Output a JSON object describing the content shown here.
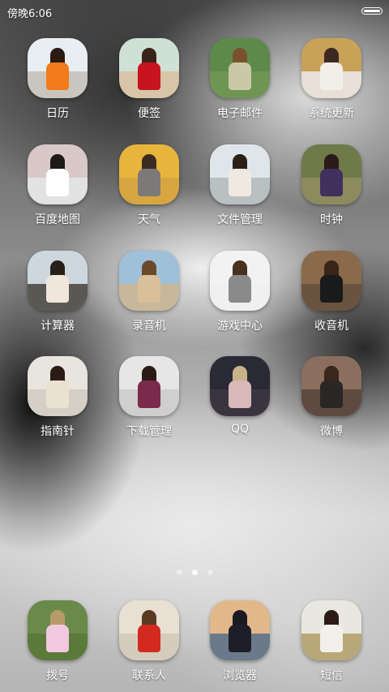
{
  "status_bar": {
    "time": "傍晚6:06"
  },
  "apps": [
    {
      "label": "日历",
      "icon": "woman-orange-dress-photo",
      "colors": {
        "sky": "#e9eef2",
        "ground": "#c9c6c0",
        "hair": "#2b1a12",
        "dress": "#f27a1a"
      }
    },
    {
      "label": "便签",
      "icon": "woman-red-dress-beach-photo",
      "colors": {
        "sky": "#cfe0d4",
        "ground": "#d8c4a6",
        "hair": "#3a2418",
        "dress": "#c8141e"
      }
    },
    {
      "label": "电子邮件",
      "icon": "woman-sequin-dress-photo",
      "colors": {
        "sky": "#5d8a4a",
        "ground": "#6f9552",
        "hair": "#7a5030",
        "dress": "#c9c9a8"
      }
    },
    {
      "label": "系统更新",
      "icon": "woman-white-top-photo",
      "colors": {
        "sky": "#c9a25a",
        "ground": "#e8e0d6",
        "hair": "#3c2a20",
        "dress": "#f2efe9"
      }
    },
    {
      "label": "百度地图",
      "icon": "woman-braid-photo",
      "colors": {
        "sky": "#d9c8c8",
        "ground": "#e2e2e2",
        "hair": "#1e1a18",
        "dress": "#ffffff"
      }
    },
    {
      "label": "天气",
      "icon": "woman-grey-dress-photo",
      "colors": {
        "sky": "#e8b53c",
        "ground": "#d8a640",
        "hair": "#3a2c22",
        "dress": "#7c7a78"
      }
    },
    {
      "label": "文件管理",
      "icon": "woman-balcony-photo",
      "colors": {
        "sky": "#dfe6ea",
        "ground": "#b9c0c2",
        "hair": "#2a2018",
        "dress": "#efe9e2"
      }
    },
    {
      "label": "时钟",
      "icon": "woman-purple-dress-photo",
      "colors": {
        "sky": "#6e7a4a",
        "ground": "#8d8a5e",
        "hair": "#2a1a18",
        "dress": "#41305e"
      }
    },
    {
      "label": "计算器",
      "icon": "woman-railing-photo",
      "colors": {
        "sky": "#cdd8de",
        "ground": "#5a5852",
        "hair": "#2a1e18",
        "dress": "#f0e6dc"
      }
    },
    {
      "label": "录音机",
      "icon": "woman-long-hair-photo",
      "colors": {
        "sky": "#9ec0d8",
        "ground": "#c8b89a",
        "hair": "#6a4a2a",
        "dress": "#d9c09a"
      }
    },
    {
      "label": "游戏中心",
      "icon": "woman-grey-tank-photo",
      "colors": {
        "sky": "#f2f2f2",
        "ground": "#f0f0f0",
        "hair": "#4a3020",
        "dress": "#8a8a8a"
      }
    },
    {
      "label": "收音机",
      "icon": "woman-black-dress-photo",
      "colors": {
        "sky": "#8a6a4a",
        "ground": "#6a5440",
        "hair": "#3a2616",
        "dress": "#1a1a1a"
      }
    },
    {
      "label": "指南针",
      "icon": "woman-cream-sweater-photo",
      "colors": {
        "sky": "#e8e4de",
        "ground": "#d6cfc6",
        "hair": "#2a1c14",
        "dress": "#eae1d0"
      }
    },
    {
      "label": "下载管理",
      "icon": "woman-floral-top-photo",
      "colors": {
        "sky": "#e6e6e6",
        "ground": "#cfcfcf",
        "hair": "#2a1c14",
        "dress": "#7a2a4a"
      }
    },
    {
      "label": "QQ",
      "icon": "woman-lace-dress-photo",
      "colors": {
        "sky": "#2a2a36",
        "ground": "#3a3440",
        "hair": "#c8b488",
        "dress": "#d8b8b8"
      }
    },
    {
      "label": "微博",
      "icon": "woman-lace-back-photo",
      "colors": {
        "sky": "#8a6e5e",
        "ground": "#5e4a40",
        "hair": "#3a261a",
        "dress": "#2a2626"
      }
    }
  ],
  "page_indicator": {
    "pages": 3,
    "current": 2
  },
  "dock": [
    {
      "label": "拨号",
      "icon": "woman-pink-dress-photo",
      "colors": {
        "sky": "#6a8a4a",
        "ground": "#5a7a3a",
        "hair": "#b89a6a",
        "dress": "#f2c8e0"
      }
    },
    {
      "label": "联系人",
      "icon": "woman-red-dress-photo",
      "colors": {
        "sky": "#e8e0d2",
        "ground": "#d6ccbc",
        "hair": "#5a3a20",
        "dress": "#d22a1e"
      }
    },
    {
      "label": "浏览器",
      "icon": "woman-sunset-beach-photo",
      "colors": {
        "sky": "#e2b88a",
        "ground": "#6a7a8a",
        "hair": "#1a1a22",
        "dress": "#1e1e2a"
      }
    },
    {
      "label": "短信",
      "icon": "woman-white-dress-field-photo",
      "colors": {
        "sky": "#e8e8e0",
        "ground": "#b8a878",
        "hair": "#2a1c14",
        "dress": "#f2f0ea"
      }
    }
  ]
}
